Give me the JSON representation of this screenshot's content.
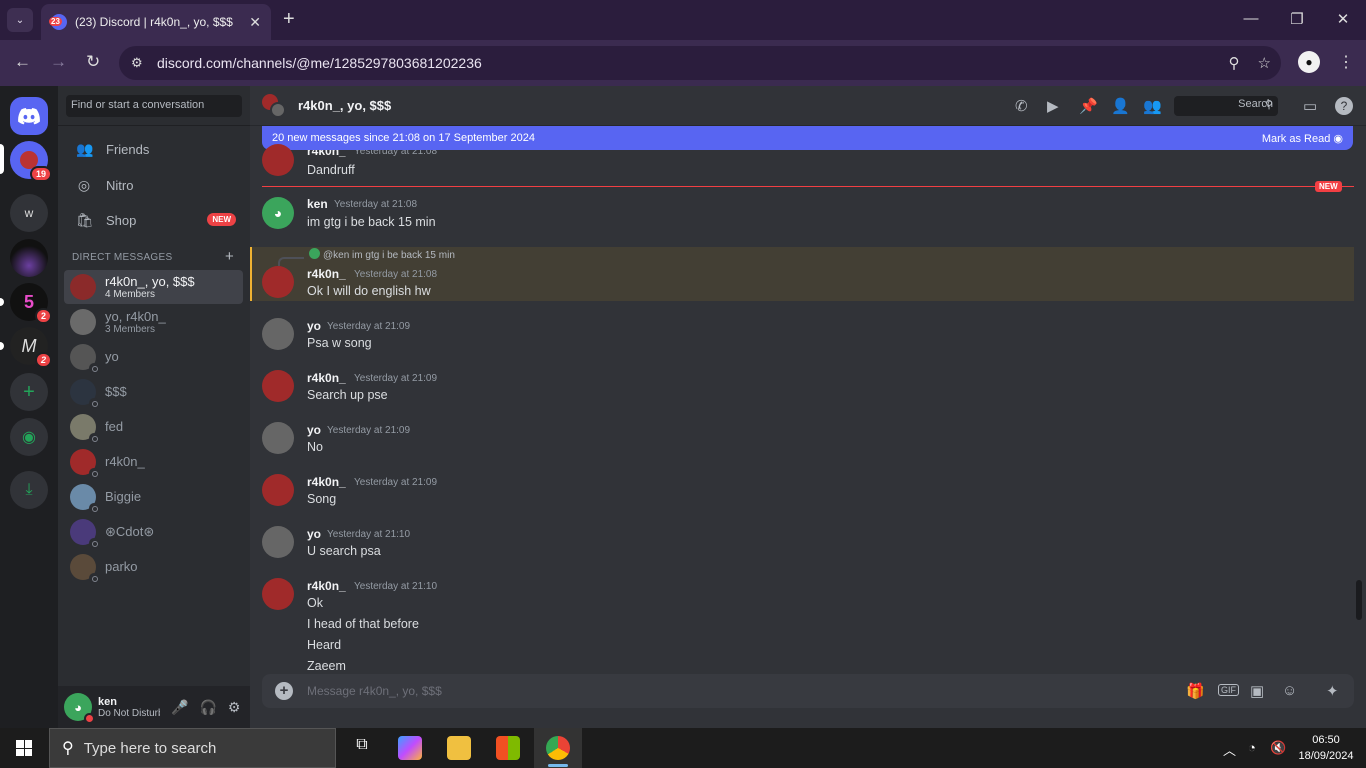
{
  "browser": {
    "tab_title": "(23) Discord | r4k0n_, yo, $$$",
    "tab_badge": "23",
    "url": "discord.com/channels/@me/1285297803681202236"
  },
  "guilds": [
    {
      "name": "home",
      "badge": ""
    },
    {
      "name": "group-dm",
      "badge": "19"
    },
    {
      "name": "w",
      "label": "w",
      "badge": ""
    },
    {
      "name": "server-dark",
      "badge": ""
    },
    {
      "name": "server-5",
      "badge": "2"
    },
    {
      "name": "server-m",
      "badge": "2"
    }
  ],
  "sidebar": {
    "search_placeholder": "Find or start a conversation",
    "nav": [
      {
        "label": "Friends",
        "icon": "friends-icon"
      },
      {
        "label": "Nitro",
        "icon": "nitro-icon"
      },
      {
        "label": "Shop",
        "icon": "shop-icon",
        "badge": "NEW"
      }
    ],
    "dm_header": "DIRECT MESSAGES",
    "dms": [
      {
        "name": "r4k0n_, yo, $$$",
        "sub": "4 Members",
        "color": "#8b2a2a"
      },
      {
        "name": "yo, r4k0n_",
        "sub": "3 Members",
        "color": "#6a6a6a"
      },
      {
        "name": "yo",
        "sub": "",
        "color": "#555555"
      },
      {
        "name": "$$$",
        "sub": "",
        "color": "#2c3440"
      },
      {
        "name": "fed",
        "sub": "",
        "color": "#7a7a6a"
      },
      {
        "name": "r4k0n_",
        "sub": "",
        "color": "#a02a2a"
      },
      {
        "name": "Biggie",
        "sub": "",
        "color": "#6a8aa8"
      },
      {
        "name": "⊛Cdot⊛",
        "sub": "",
        "color": "#4a3a7a"
      },
      {
        "name": "parko",
        "sub": "",
        "color": "#5a4a3a"
      }
    ]
  },
  "user": {
    "name": "ken",
    "status": "Do Not Disturb"
  },
  "chat": {
    "title": "r4k0n_, yo, $$$",
    "search_placeholder": "Search",
    "banner_text": "20 new messages since 21:08 on 17 September 2024",
    "banner_action": "Mark as Read",
    "new_tag": "NEW",
    "reply_preview": "@ken im gtg i be back 15 min",
    "messages": [
      {
        "author": "r4k0n_",
        "time": "Yesterday at 21:08",
        "lines": [
          "Dandruff"
        ]
      },
      {
        "author": "ken",
        "time": "Yesterday at 21:08",
        "lines": [
          "im gtg i be back 15 min"
        ]
      },
      {
        "author": "r4k0n_",
        "time": "Yesterday at 21:08",
        "lines": [
          "Ok I will do english hw"
        ]
      },
      {
        "author": "yo",
        "time": "Yesterday at 21:09",
        "lines": [
          "Psa w song"
        ]
      },
      {
        "author": "r4k0n_",
        "time": "Yesterday at 21:09",
        "lines": [
          "Search up pse"
        ]
      },
      {
        "author": "yo",
        "time": "Yesterday at 21:09",
        "lines": [
          "No"
        ]
      },
      {
        "author": "r4k0n_",
        "time": "Yesterday at 21:09",
        "lines": [
          "Song"
        ]
      },
      {
        "author": "yo",
        "time": "Yesterday at 21:10",
        "lines": [
          "U search psa"
        ]
      },
      {
        "author": "r4k0n_",
        "time": "Yesterday at 21:10",
        "lines": [
          "Ok",
          "I head of that before",
          "Heard",
          "Zaeem"
        ]
      }
    ],
    "composer_placeholder": "Message r4k0n_, yo, $$$"
  },
  "taskbar": {
    "search_placeholder": "Type here to search",
    "time": "06:50",
    "date": "18/09/2024"
  }
}
